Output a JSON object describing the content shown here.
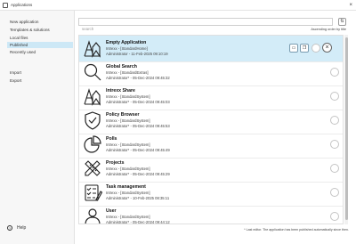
{
  "window": {
    "title": "Applications",
    "close_label": "×"
  },
  "sidebar": {
    "items": [
      {
        "label": "New application"
      },
      {
        "label": "Templates & solutions"
      },
      {
        "label": "Local files"
      },
      {
        "label": "Published"
      },
      {
        "label": "Recently used"
      },
      {
        "label": "Import"
      },
      {
        "label": "Export"
      }
    ],
    "help_label": "Help"
  },
  "search": {
    "placeholder": "search",
    "value": ""
  },
  "sort": {
    "label": "Ascending order by title"
  },
  "apps": [
    {
      "name": "Empty Application",
      "sub": "Intrexx - [StandardHome]",
      "meta": "Administrator - 11-Feb-2025 09:10:19",
      "icon": "empty-application-icon"
    },
    {
      "name": "Global Search",
      "sub": "Intrexx - [StandardExtras]",
      "meta": "Administrator* - 05-Dec-2024 09:45:32",
      "icon": "magnifier-icon"
    },
    {
      "name": "Intrexx Share",
      "sub": "Intrexx - [StandardSystem]",
      "meta": "Administrator* - 05-Dec-2024 09:45:03",
      "icon": "intrexx-share-icon"
    },
    {
      "name": "Policy Browser",
      "sub": "Intrexx - [StandardSystem]",
      "meta": "Administrator* - 05-Dec-2024 09:45:53",
      "icon": "shield-icon"
    },
    {
      "name": "Polls",
      "sub": "Intrexx - [StandardSystem]",
      "meta": "Administrator* - 05-Dec-2024 09:45:49",
      "icon": "pie-chart-icon"
    },
    {
      "name": "Projects",
      "sub": "Intrexx - [StandardSystem]",
      "meta": "Administrator* - 05-Dec-2024 09:45:29",
      "icon": "pencil-ruler-icon"
    },
    {
      "name": "Task management",
      "sub": "Intrexx - [StandardSystem]",
      "meta": "Administrator* - 10-Feb-2025 08:35:11",
      "icon": "checklist-icon"
    },
    {
      "name": "User",
      "sub": "Intrexx - [StandardSystem]",
      "meta": "Administrator* - 05-Dec-2024 09:44:12",
      "icon": "user-icon"
    }
  ],
  "footnote": "* Last editor. The application has been published automatically since then.",
  "colors": {
    "selected_row": "#d3ecf8",
    "active_sidebar": "#cde8f6"
  }
}
